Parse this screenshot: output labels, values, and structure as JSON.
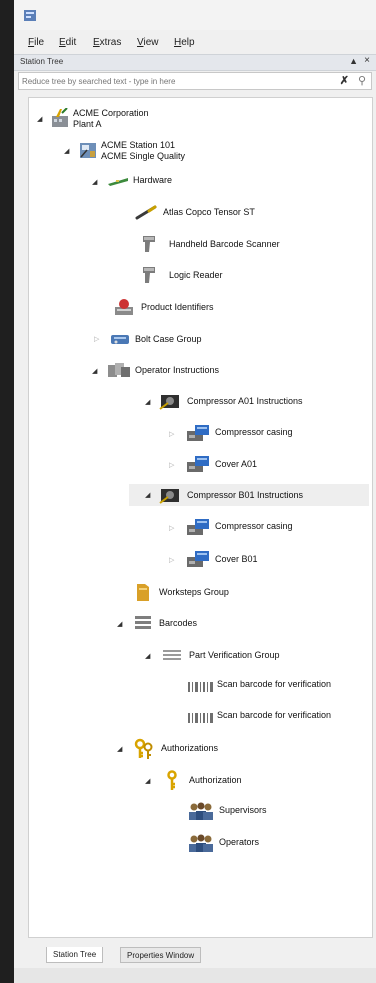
{
  "menu": {
    "file": "File",
    "edit": "Edit",
    "extras": "Extras",
    "view": "View",
    "help": "Help"
  },
  "panel": {
    "title": "Station Tree",
    "pin_icon": "pin-icon",
    "close_icon": "close-icon"
  },
  "filter": {
    "placeholder": "Reduce tree by searched text - type in here"
  },
  "tree": {
    "root": {
      "line1": "ACME Corporation",
      "line2": "Plant A"
    },
    "station": {
      "line1": "ACME Station 101",
      "line2": "ACME Single Quality"
    },
    "hardware": "Hardware",
    "tool": "Atlas Copco Tensor ST",
    "scanner": "Handheld Barcode Scanner",
    "reader": "Logic Reader",
    "product_identifiers": "Product Identifiers",
    "bolt_group": "Bolt Case Group",
    "operator_instructions": "Operator Instructions",
    "comp_a01": "Compressor A01 Instructions",
    "comp_a01_casing": "Compressor casing",
    "cover_a01": "Cover A01",
    "comp_b01": "Compressor B01 Instructions",
    "comp_b01_casing": "Compressor casing",
    "cover_b01": "Cover B01",
    "worksteps_group": "Worksteps Group",
    "barcodes": "Barcodes",
    "part_verification_group": "Part Verification Group",
    "scan1": "Scan barcode for verification",
    "scan2": "Scan barcode for verification",
    "authorizations": "Authorizations",
    "authorization": "Authorization",
    "supervisors": "Supervisors",
    "operators": "Operators"
  },
  "tabs": {
    "station_tree": "Station Tree",
    "properties_window": "Properties Window"
  },
  "colors": {
    "background": "#f0f0f0",
    "tree_background": "#ffffff",
    "selection": "#eeeeee"
  }
}
